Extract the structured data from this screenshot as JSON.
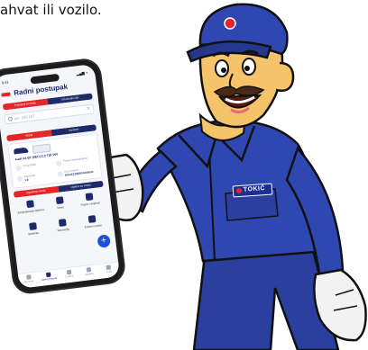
{
  "intro": {
    "text_fragment": "ahvat ili vozilo."
  },
  "brand": {
    "badge_text": "TOKIĆ"
  },
  "phone": {
    "status": {
      "time": "9:41",
      "icons": "▂▄▆ ◖"
    },
    "title": "Radni postupak",
    "segment_top": {
      "left": "Postupak po broju",
      "right": "Univerzalni dio"
    },
    "search": {
      "placeholder": "npr. 1K0 167",
      "clear": "✕"
    },
    "segment_mid": {
      "left": "Vozila",
      "right": "Kamioni"
    },
    "vehicle": "Audi A4 B7 (8EC) 2.0 TDI 16V",
    "fields": [
      {
        "label": "Proizvođač",
        "value": ""
      },
      {
        "label": "Prema kategorijama",
        "value": ""
      },
      {
        "label": "Kapacitet",
        "value": "1.9"
      },
      {
        "label": "Broj motora",
        "value": "WAUZZZ8E87A000000"
      }
    ],
    "segment_low": {
      "left": "Zajednica vozila",
      "right": "Dijelovi za vozilo"
    },
    "tiles": [
      {
        "label": "Zamjenjivanje dijelova"
      },
      {
        "label": "Motor"
      },
      {
        "label": "Pogon i prijenos"
      },
      {
        "label": "Elektrika"
      },
      {
        "label": "Karoserija"
      },
      {
        "label": "Kočioni sustav"
      }
    ],
    "fab": "+",
    "tabs": [
      {
        "label": "Početna"
      },
      {
        "label": "Radni postupak"
      },
      {
        "label": "Tražilica"
      },
      {
        "label": "Košarica"
      },
      {
        "label": "Profil"
      }
    ]
  }
}
